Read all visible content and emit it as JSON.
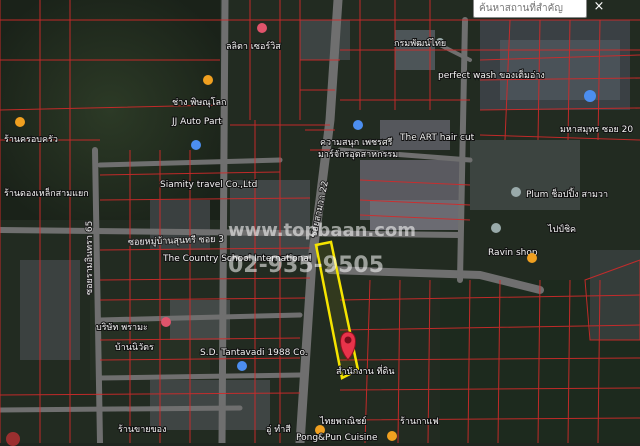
{
  "search": {
    "placeholder": "ค้นหาสถานที่สำคัญ"
  },
  "close_label": "×",
  "watermark": {
    "site": "www.topbaan.com",
    "phone": "02-935-9505"
  },
  "roads": [
    {
      "name": "ซอยสามวา 22"
    },
    {
      "name": "ซอยหมู่บ้านสุนทรี ซอย 3"
    },
    {
      "name": "ซอยรามอินทรา 65"
    }
  ],
  "places": [
    {
      "name": "ลลิตา เซอร์วิส",
      "kind": "shop",
      "color": "#e0546b"
    },
    {
      "name": "กรมพัฒน์ไทย",
      "kind": "poi",
      "color": "#9aa"
    },
    {
      "name": "perfect wash ของเต็มอ่าง",
      "kind": "poi",
      "color": "#9aa"
    },
    {
      "name": "มาร์จักรอุตสาหกรรม",
      "kind": "poi",
      "color": "#9aa"
    },
    {
      "name": "ช่าง พิษณุโลก",
      "kind": "food",
      "color": "#f0a020"
    },
    {
      "name": "JJ Auto Part",
      "kind": "poi",
      "color": "#9aa"
    },
    {
      "name": "ร้านครอบครัว",
      "kind": "food",
      "color": "#f0a020"
    },
    {
      "name": "ร้านดองเหล็กสามแยก",
      "kind": "poi",
      "color": "#9aa"
    },
    {
      "name": "ความสนุก เพชรศรี",
      "kind": "poi",
      "color": "#4c8ef0"
    },
    {
      "name": "The ART hair cut",
      "kind": "poi",
      "color": "#4c8ef0"
    },
    {
      "name": "มหาสมุทร ซอย 20",
      "kind": "poi",
      "color": "#4c8ef0"
    },
    {
      "name": "Siamity travel Co.,Ltd",
      "kind": "travel",
      "color": "#4c8ef0"
    },
    {
      "name": "Plum ช็อปปิ้ง สามวา",
      "kind": "shop",
      "color": "#9aa"
    },
    {
      "name": "The Country School International",
      "kind": "school",
      "color": "#9aa"
    },
    {
      "name": "Ravin shop",
      "kind": "shop",
      "color": "#9aa"
    },
    {
      "name": "ไปป์ชิค",
      "kind": "shop",
      "color": "#f0a020"
    },
    {
      "name": "บริษัท พรามะ",
      "kind": "shop",
      "color": "#e0546b"
    },
    {
      "name": "บ้านนิวัตร",
      "kind": "poi",
      "color": "#9aa"
    },
    {
      "name": "S.D. Tantavadi 1988 Co.",
      "kind": "poi",
      "color": "#4c8ef0"
    },
    {
      "name": "ร้านขายของ",
      "kind": "poi",
      "color": "#9aa"
    },
    {
      "name": "Pong&Pun Cuisine",
      "kind": "food",
      "color": "#f0a020"
    },
    {
      "name": "ร้านกาแฟ",
      "kind": "food",
      "color": "#f0a020"
    },
    {
      "name": "สำนักงาน ที่ดิน",
      "kind": "poi",
      "color": "#9aa"
    },
    {
      "name": "ไทยพาณิชย์",
      "kind": "shop",
      "color": "#e0546b"
    },
    {
      "name": "อู่ ทำสี",
      "kind": "poi",
      "color": "#9aa"
    }
  ],
  "highlight_plot": {
    "stroke": "#f5e400"
  },
  "marker": {
    "color": "#e8334a"
  }
}
